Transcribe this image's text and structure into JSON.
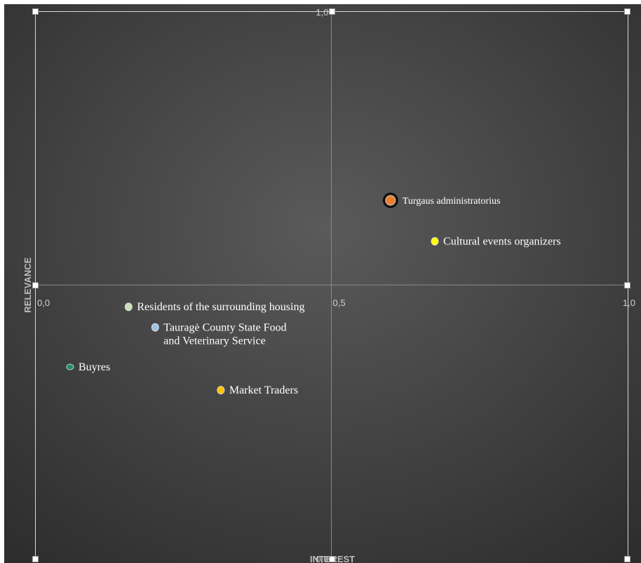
{
  "chart_data": {
    "type": "scatter",
    "xlabel": "INTEREST",
    "ylabel": "RELEVANCE",
    "xlim": [
      0,
      1
    ],
    "ylim": [
      -1,
      1
    ],
    "grid": true,
    "x_ticks": [
      "0,0",
      "0,5",
      "1,0"
    ],
    "y_ticks": [
      "1,0",
      "0,0"
    ],
    "points": [
      {
        "label": "Turgaus administratorius",
        "x": 0.6,
        "y": 0.31,
        "color": "#ed7d31"
      },
      {
        "label": "Cultural events organizers",
        "x": 0.675,
        "y": 0.16,
        "color": "#ffff00"
      },
      {
        "label": "Residents of the surrounding housing",
        "x": 0.157,
        "y": -0.08,
        "color": "#c5e0b4"
      },
      {
        "label": "Tauragė County State Food and Veterinary Service",
        "x": 0.202,
        "y": -0.155,
        "color": "#9dc3e6"
      },
      {
        "label": "Buyres",
        "x": 0.058,
        "y": -0.3,
        "color": "#1f8a70"
      },
      {
        "label": "Market Traders",
        "x": 0.313,
        "y": -0.385,
        "color": "#ffc000"
      }
    ]
  }
}
